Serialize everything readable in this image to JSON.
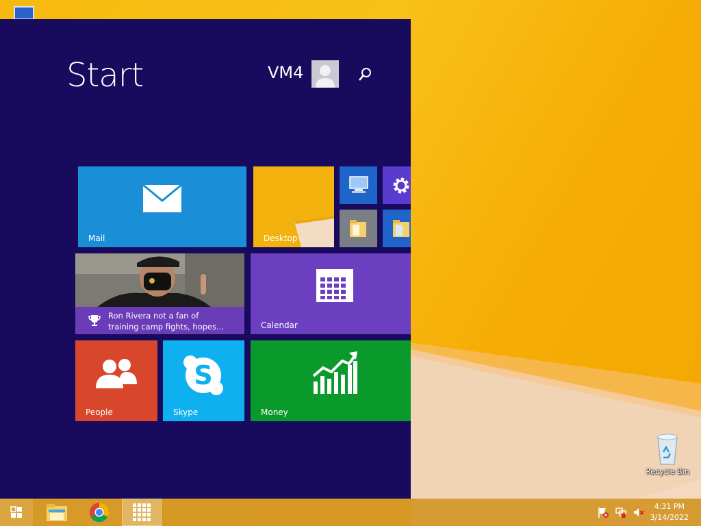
{
  "start": {
    "title": "Start",
    "user_name": "VM4"
  },
  "tiles": {
    "mail": "Mail",
    "desktop": "Desktop",
    "calendar": "Calendar",
    "people": "People",
    "skype": "Skype",
    "money": "Money",
    "news_headline_line1": "Ron Rivera not a fan of",
    "news_headline_line2": "training camp fights, hopes..."
  },
  "desktop": {
    "recycle_bin_label": "Recycle Bin"
  },
  "taskbar": {
    "time": "4:31 PM",
    "date": "3/14/2022"
  },
  "colors": {
    "start_bg": "#180a5c",
    "mail": "#1a8fd7",
    "calendar": "#6b3fc0",
    "people": "#d8472c",
    "skype": "#0fb0ef",
    "money": "#0a9a2c",
    "small_blue": "#1f64c8",
    "small_purple": "#5a3bd0"
  }
}
